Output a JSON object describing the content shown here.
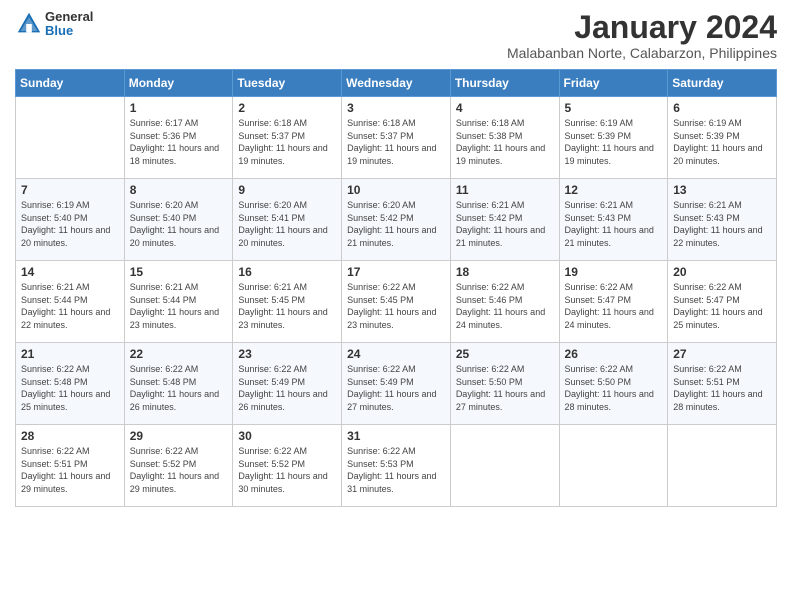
{
  "logo": {
    "general": "General",
    "blue": "Blue"
  },
  "title": "January 2024",
  "subtitle": "Malabanban Norte, Calabarzon, Philippines",
  "days_header": [
    "Sunday",
    "Monday",
    "Tuesday",
    "Wednesday",
    "Thursday",
    "Friday",
    "Saturday"
  ],
  "weeks": [
    [
      {
        "day": "",
        "sunrise": "",
        "sunset": "",
        "daylight": ""
      },
      {
        "day": "1",
        "sunrise": "6:17 AM",
        "sunset": "5:36 PM",
        "daylight": "11 hours and 18 minutes."
      },
      {
        "day": "2",
        "sunrise": "6:18 AM",
        "sunset": "5:37 PM",
        "daylight": "11 hours and 19 minutes."
      },
      {
        "day": "3",
        "sunrise": "6:18 AM",
        "sunset": "5:37 PM",
        "daylight": "11 hours and 19 minutes."
      },
      {
        "day": "4",
        "sunrise": "6:18 AM",
        "sunset": "5:38 PM",
        "daylight": "11 hours and 19 minutes."
      },
      {
        "day": "5",
        "sunrise": "6:19 AM",
        "sunset": "5:39 PM",
        "daylight": "11 hours and 19 minutes."
      },
      {
        "day": "6",
        "sunrise": "6:19 AM",
        "sunset": "5:39 PM",
        "daylight": "11 hours and 20 minutes."
      }
    ],
    [
      {
        "day": "7",
        "sunrise": "6:19 AM",
        "sunset": "5:40 PM",
        "daylight": "11 hours and 20 minutes."
      },
      {
        "day": "8",
        "sunrise": "6:20 AM",
        "sunset": "5:40 PM",
        "daylight": "11 hours and 20 minutes."
      },
      {
        "day": "9",
        "sunrise": "6:20 AM",
        "sunset": "5:41 PM",
        "daylight": "11 hours and 20 minutes."
      },
      {
        "day": "10",
        "sunrise": "6:20 AM",
        "sunset": "5:42 PM",
        "daylight": "11 hours and 21 minutes."
      },
      {
        "day": "11",
        "sunrise": "6:21 AM",
        "sunset": "5:42 PM",
        "daylight": "11 hours and 21 minutes."
      },
      {
        "day": "12",
        "sunrise": "6:21 AM",
        "sunset": "5:43 PM",
        "daylight": "11 hours and 21 minutes."
      },
      {
        "day": "13",
        "sunrise": "6:21 AM",
        "sunset": "5:43 PM",
        "daylight": "11 hours and 22 minutes."
      }
    ],
    [
      {
        "day": "14",
        "sunrise": "6:21 AM",
        "sunset": "5:44 PM",
        "daylight": "11 hours and 22 minutes."
      },
      {
        "day": "15",
        "sunrise": "6:21 AM",
        "sunset": "5:44 PM",
        "daylight": "11 hours and 23 minutes."
      },
      {
        "day": "16",
        "sunrise": "6:21 AM",
        "sunset": "5:45 PM",
        "daylight": "11 hours and 23 minutes."
      },
      {
        "day": "17",
        "sunrise": "6:22 AM",
        "sunset": "5:45 PM",
        "daylight": "11 hours and 23 minutes."
      },
      {
        "day": "18",
        "sunrise": "6:22 AM",
        "sunset": "5:46 PM",
        "daylight": "11 hours and 24 minutes."
      },
      {
        "day": "19",
        "sunrise": "6:22 AM",
        "sunset": "5:47 PM",
        "daylight": "11 hours and 24 minutes."
      },
      {
        "day": "20",
        "sunrise": "6:22 AM",
        "sunset": "5:47 PM",
        "daylight": "11 hours and 25 minutes."
      }
    ],
    [
      {
        "day": "21",
        "sunrise": "6:22 AM",
        "sunset": "5:48 PM",
        "daylight": "11 hours and 25 minutes."
      },
      {
        "day": "22",
        "sunrise": "6:22 AM",
        "sunset": "5:48 PM",
        "daylight": "11 hours and 26 minutes."
      },
      {
        "day": "23",
        "sunrise": "6:22 AM",
        "sunset": "5:49 PM",
        "daylight": "11 hours and 26 minutes."
      },
      {
        "day": "24",
        "sunrise": "6:22 AM",
        "sunset": "5:49 PM",
        "daylight": "11 hours and 27 minutes."
      },
      {
        "day": "25",
        "sunrise": "6:22 AM",
        "sunset": "5:50 PM",
        "daylight": "11 hours and 27 minutes."
      },
      {
        "day": "26",
        "sunrise": "6:22 AM",
        "sunset": "5:50 PM",
        "daylight": "11 hours and 28 minutes."
      },
      {
        "day": "27",
        "sunrise": "6:22 AM",
        "sunset": "5:51 PM",
        "daylight": "11 hours and 28 minutes."
      }
    ],
    [
      {
        "day": "28",
        "sunrise": "6:22 AM",
        "sunset": "5:51 PM",
        "daylight": "11 hours and 29 minutes."
      },
      {
        "day": "29",
        "sunrise": "6:22 AM",
        "sunset": "5:52 PM",
        "daylight": "11 hours and 29 minutes."
      },
      {
        "day": "30",
        "sunrise": "6:22 AM",
        "sunset": "5:52 PM",
        "daylight": "11 hours and 30 minutes."
      },
      {
        "day": "31",
        "sunrise": "6:22 AM",
        "sunset": "5:53 PM",
        "daylight": "11 hours and 31 minutes."
      },
      {
        "day": "",
        "sunrise": "",
        "sunset": "",
        "daylight": ""
      },
      {
        "day": "",
        "sunrise": "",
        "sunset": "",
        "daylight": ""
      },
      {
        "day": "",
        "sunrise": "",
        "sunset": "",
        "daylight": ""
      }
    ]
  ],
  "labels": {
    "sunrise": "Sunrise:",
    "sunset": "Sunset:",
    "daylight": "Daylight:"
  }
}
